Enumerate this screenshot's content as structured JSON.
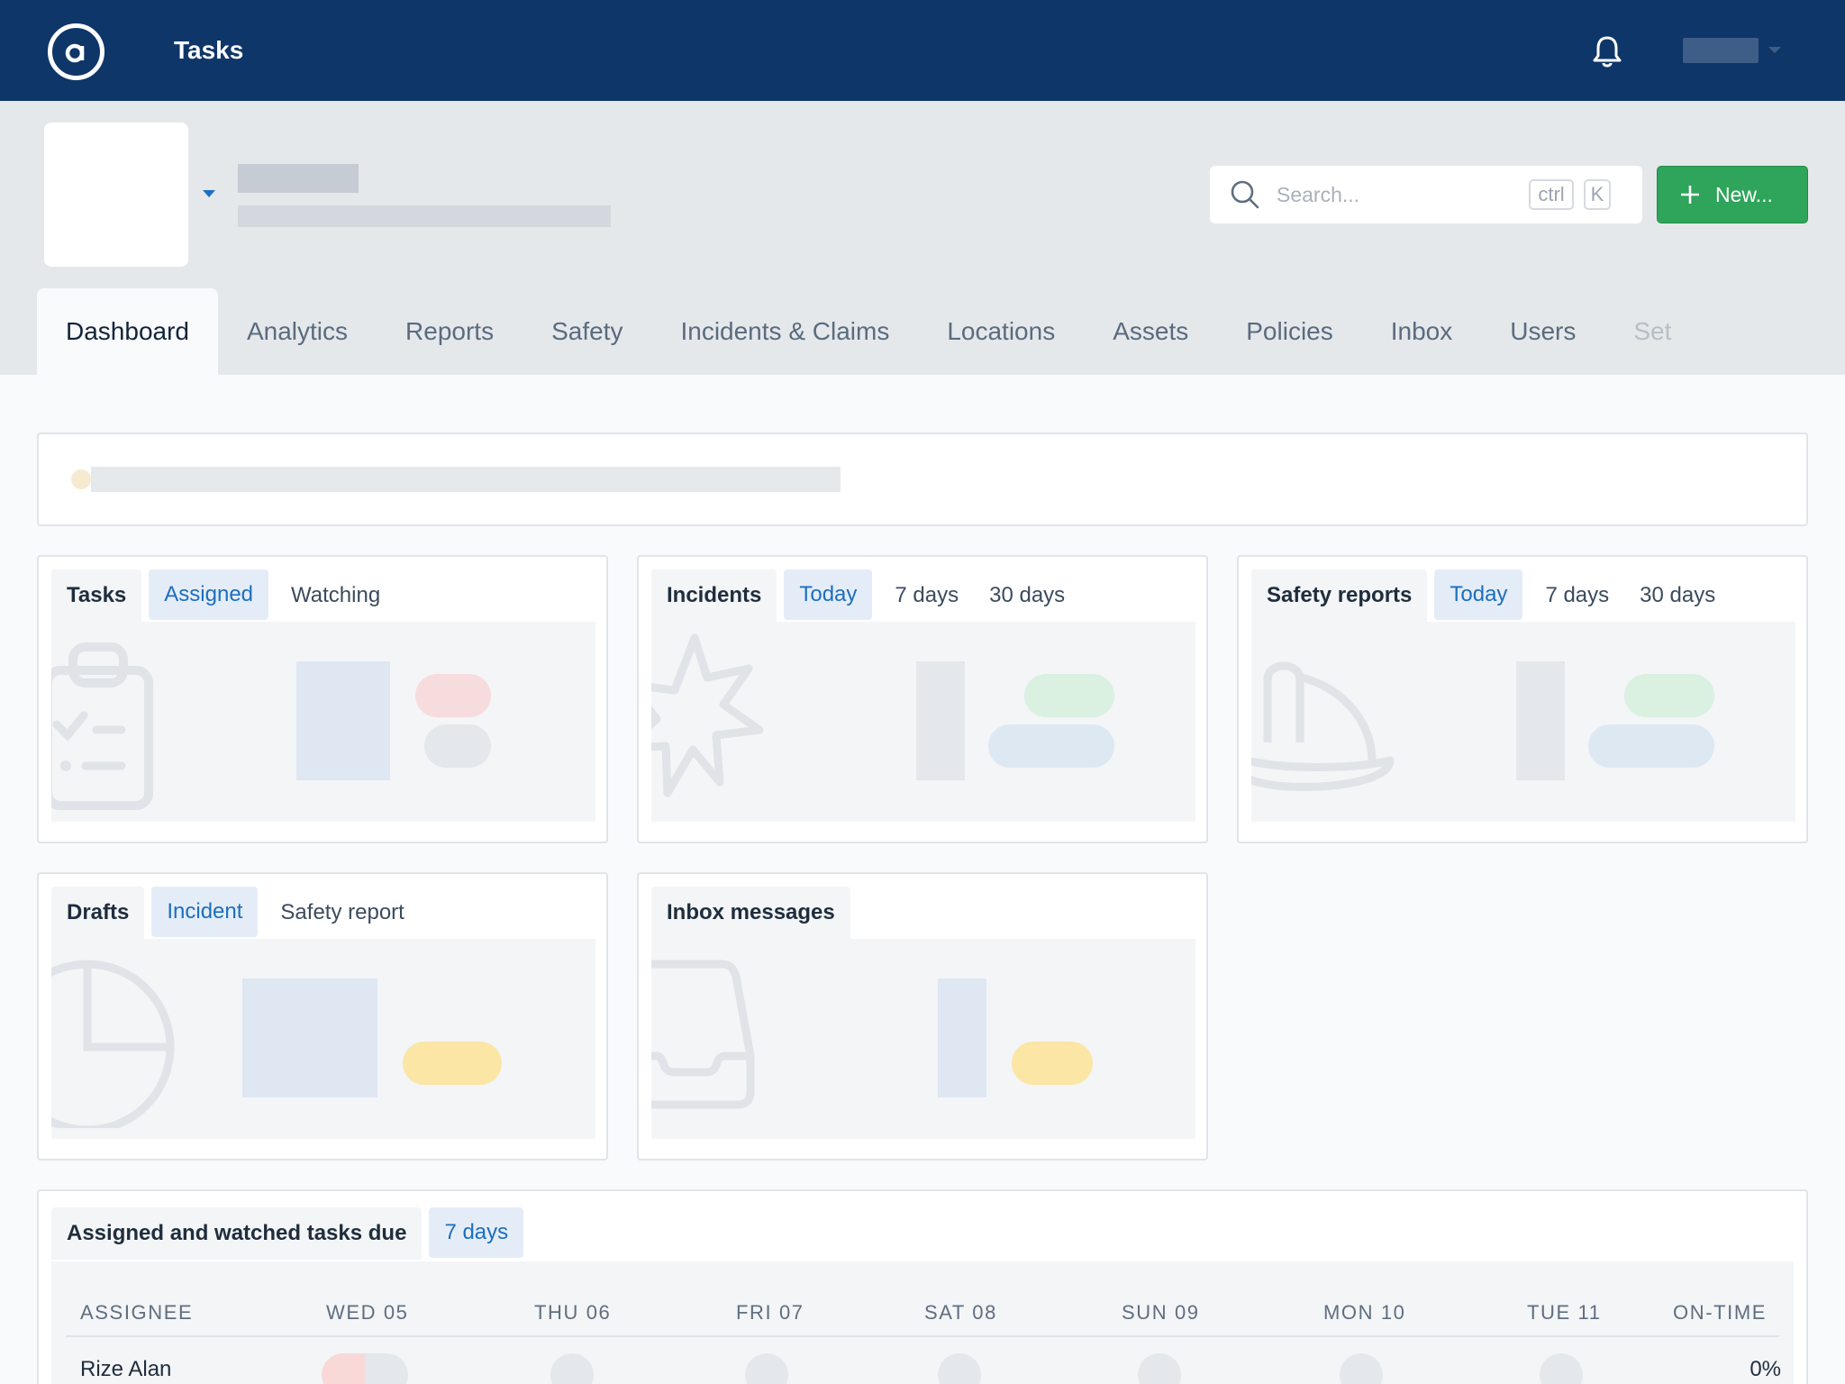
{
  "app": {
    "title": "Tasks"
  },
  "search": {
    "placeholder": "Search...",
    "shortcut_ctrl": "ctrl",
    "shortcut_key": "K"
  },
  "actions": {
    "new_label": "New..."
  },
  "nav": {
    "tabs": [
      "Dashboard",
      "Analytics",
      "Reports",
      "Safety",
      "Incidents & Claims",
      "Locations",
      "Assets",
      "Policies",
      "Inbox",
      "Users",
      "Set"
    ],
    "active": "Dashboard"
  },
  "cards": {
    "tasks": {
      "title": "Tasks",
      "tabs": [
        "Assigned",
        "Watching"
      ],
      "selected": "Assigned"
    },
    "incidents": {
      "title": "Incidents",
      "tabs": [
        "Today",
        "7 days",
        "30 days"
      ],
      "selected": "Today"
    },
    "safety_reports": {
      "title": "Safety reports",
      "tabs": [
        "Today",
        "7 days",
        "30 days"
      ],
      "selected": "Today"
    },
    "drafts": {
      "title": "Drafts",
      "tabs": [
        "Incident",
        "Safety report"
      ],
      "selected": "Incident"
    },
    "inbox": {
      "title": "Inbox messages"
    }
  },
  "due_table": {
    "title": "Assigned and watched tasks due",
    "range": "7 days",
    "columns": [
      "ASSIGNEE",
      "WED 05",
      "THU 06",
      "FRI 07",
      "SAT 08",
      "SUN 09",
      "MON 10",
      "TUE 11",
      "ON-TIME"
    ],
    "rows": [
      {
        "assignee": "Rize Alan",
        "on_time": "0%"
      }
    ]
  },
  "colors": {
    "topbar": "#0f3669",
    "primary_button": "#2ea55a",
    "selected_tab_text": "#1d6ebf",
    "selected_tab_bg": "#e4edf7"
  }
}
